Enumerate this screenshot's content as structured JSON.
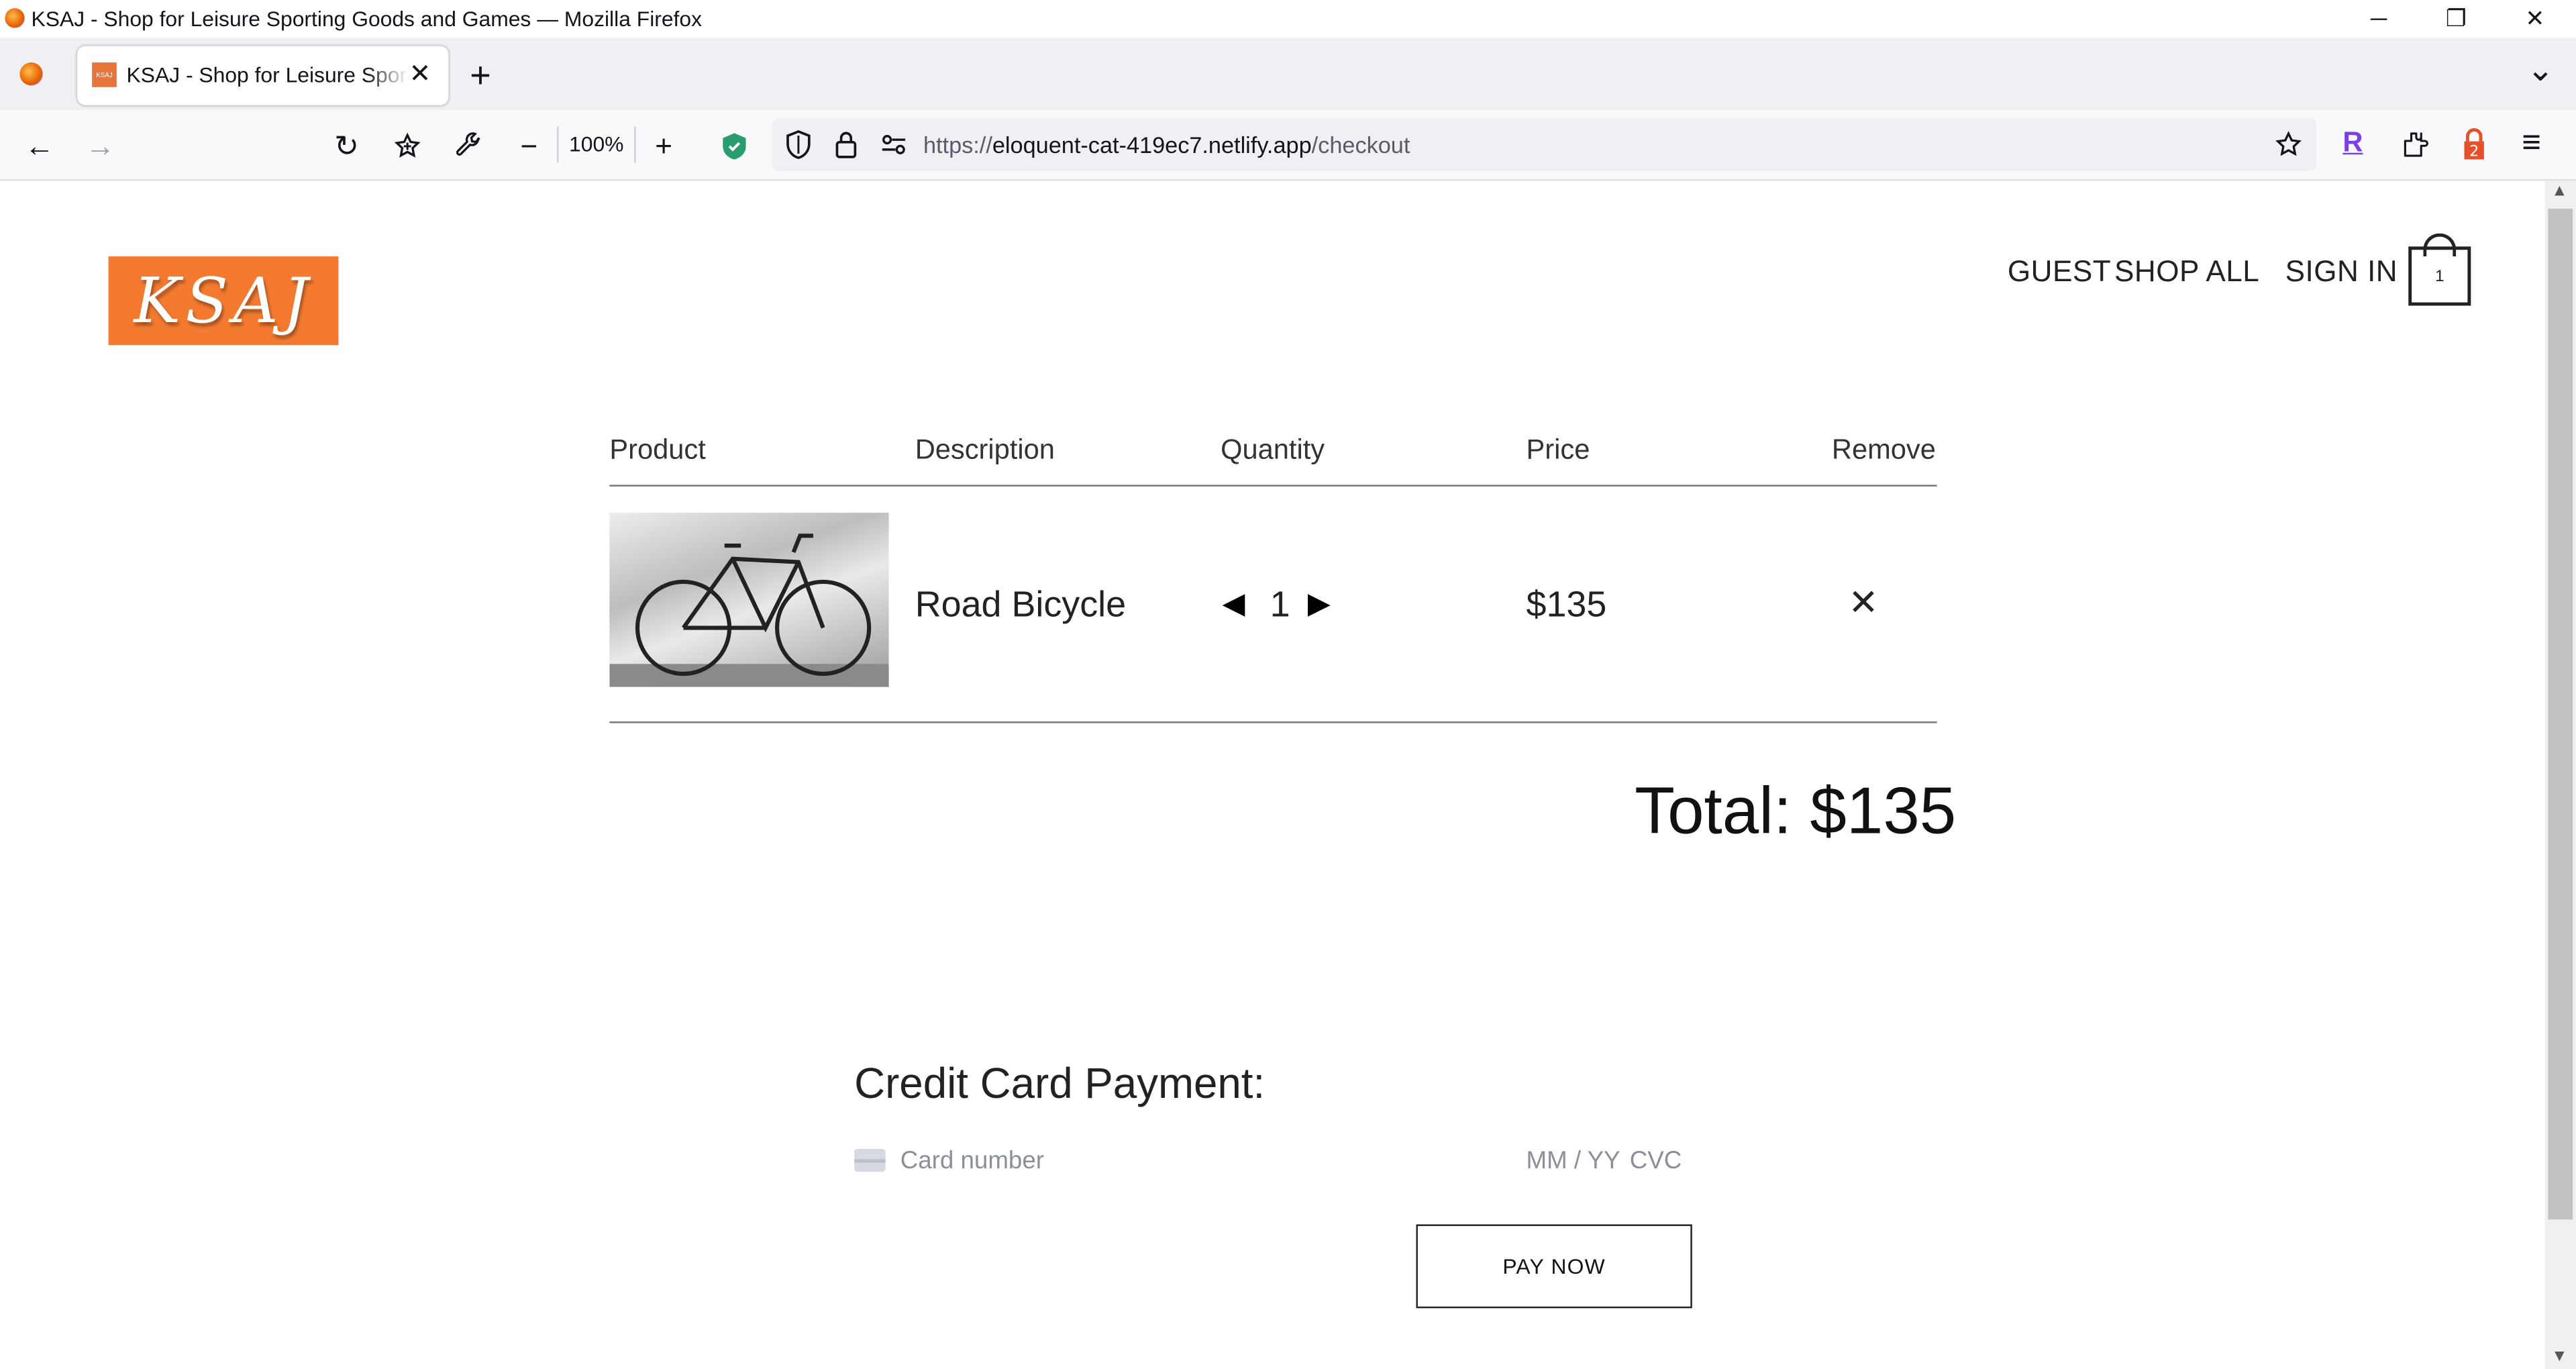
{
  "window": {
    "title": "KSAJ - Shop for Leisure Sporting Goods and Games — Mozilla Firefox",
    "minimize": "─",
    "restore": "❐",
    "close": "✕"
  },
  "tabs": [
    {
      "favicon_text": "KSAJ",
      "label": "KSAJ - Shop for Leisure Sporting Goods and Games",
      "close": "✕"
    }
  ],
  "tabstrip": {
    "new_tab": "+",
    "list_all": "⌄"
  },
  "toolbar": {
    "back": "←",
    "forward": "→",
    "reload": "↻",
    "zoom_out": "−",
    "zoom_level": "100%",
    "zoom_in": "+",
    "url_scheme": "https://",
    "url_host": "eloquent-cat-419ec7.netlify.app",
    "url_path": "/checkout",
    "extension_r": "R",
    "menu": "≡"
  },
  "site": {
    "logo": "KSAJ",
    "nav": {
      "guest": "GUEST",
      "shop_all": "SHOP ALL",
      "sign_in": "SIGN IN"
    },
    "cart_count": "1"
  },
  "cart": {
    "headers": {
      "product": "Product",
      "description": "Description",
      "quantity": "Quantity",
      "price": "Price",
      "remove": "Remove"
    },
    "items": [
      {
        "description": "Road Bicycle",
        "quantity": "1",
        "price": "$135",
        "decrease": "◀",
        "increase": "▶",
        "remove": "✕"
      }
    ],
    "total": "Total: $135"
  },
  "payment": {
    "title": "Credit Card Payment:",
    "card_number_placeholder": "Card number",
    "expiry_placeholder": "MM / YY",
    "cvc_placeholder": "CVC",
    "pay_button": "PAY NOW"
  },
  "colors": {
    "logo_bg": "#f47a30",
    "shield_green": "#2a9d6f",
    "ext_purple": "#7b3fe4"
  }
}
